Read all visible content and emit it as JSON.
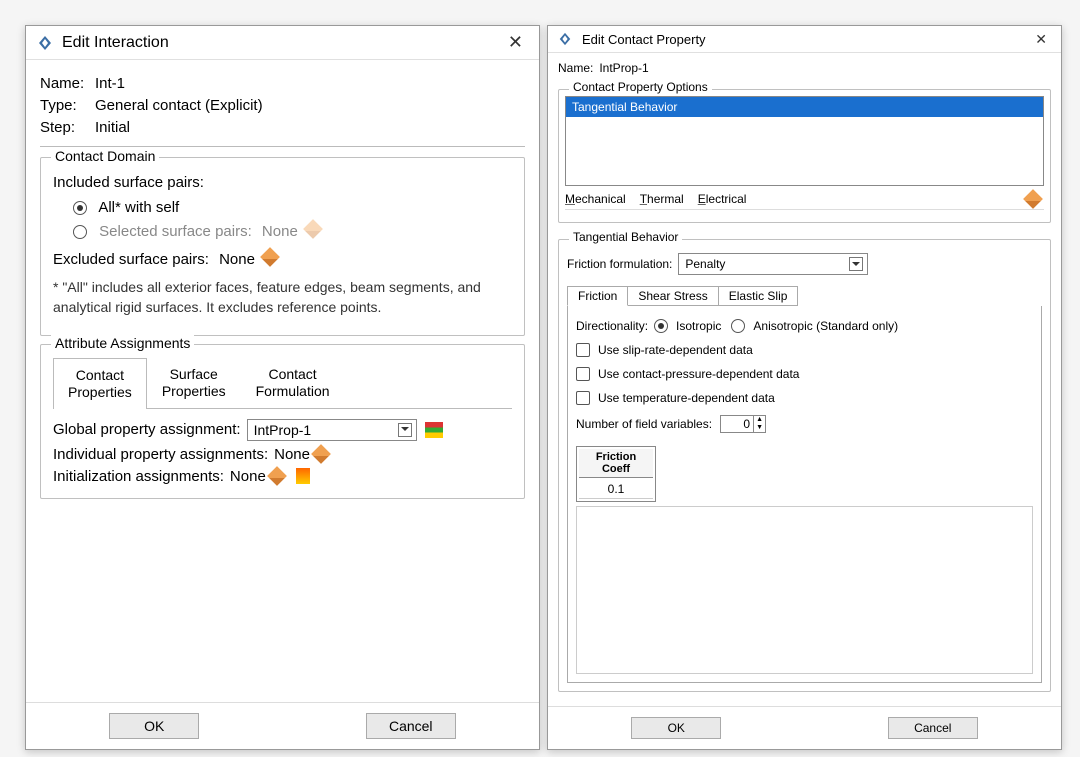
{
  "left": {
    "title": "Edit Interaction",
    "name_label": "Name:",
    "name_value": "Int-1",
    "type_label": "Type:",
    "type_value": "General contact (Explicit)",
    "step_label": "Step:",
    "step_value": "Initial",
    "contact_domain": {
      "legend": "Contact Domain",
      "included_label": "Included surface pairs:",
      "radio_all": "All* with self",
      "radio_selected": "Selected surface pairs:",
      "selected_value": "None",
      "excluded_label": "Excluded surface pairs:",
      "excluded_value": "None",
      "note": "* \"All\" includes all exterior faces, feature edges, beam segments, and analytical rigid surfaces. It excludes reference points."
    },
    "attribute": {
      "legend": "Attribute Assignments",
      "tabs": [
        "Contact\nProperties",
        "Surface\nProperties",
        "Contact\nFormulation"
      ],
      "global_label": "Global property assignment:",
      "global_value": "IntProp-1",
      "individual_label": "Individual property assignments:",
      "individual_value": "None",
      "init_label": "Initialization assignments:",
      "init_value": "None"
    },
    "ok": "OK",
    "cancel": "Cancel"
  },
  "right": {
    "title": "Edit Contact Property",
    "name_label": "Name:",
    "name_value": "IntProp-1",
    "options_legend": "Contact Property Options",
    "option_item": "Tangential Behavior",
    "menus": {
      "mech": "Mechanical",
      "thermal": "Thermal",
      "elec": "Electrical"
    },
    "section": {
      "legend": "Tangential Behavior",
      "friction_formulation_label": "Friction formulation:",
      "friction_formulation_value": "Penalty",
      "sub_tabs": [
        "Friction",
        "Shear Stress",
        "Elastic Slip"
      ],
      "directionality_label": "Directionality:",
      "dir_iso": "Isotropic",
      "dir_aniso": "Anisotropic (Standard only)",
      "chk_slip": "Use slip-rate-dependent data",
      "chk_pressure": "Use contact-pressure-dependent data",
      "chk_temp": "Use temperature-dependent data",
      "field_vars_label": "Number of field variables:",
      "field_vars_value": "0",
      "table_header": "Friction\nCoeff",
      "table_value": "0.1"
    },
    "ok": "OK",
    "cancel": "Cancel"
  }
}
